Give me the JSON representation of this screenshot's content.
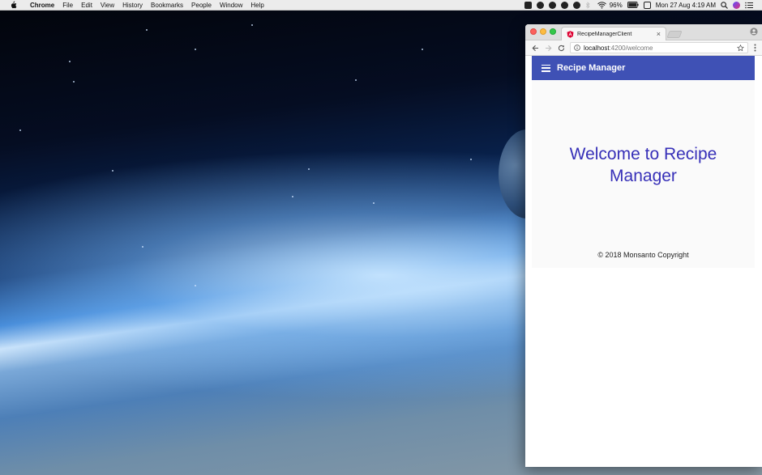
{
  "menubar": {
    "app_name": "Chrome",
    "items": [
      "File",
      "Edit",
      "View",
      "History",
      "Bookmarks",
      "People",
      "Window",
      "Help"
    ],
    "battery": "96%",
    "clock": "Mon 27 Aug  4:19 AM"
  },
  "browser": {
    "tab_title": "RecipeManagerClient",
    "tab_close": "×",
    "url_host": "localhost",
    "url_path": ":4200/welcome"
  },
  "app": {
    "title": "Recipe Manager",
    "welcome_line1": "Welcome to Recipe",
    "welcome_line2": "Manager",
    "footer": "© 2018 Monsanto Copyright",
    "accent_color": "#3f51b5",
    "heading_color": "#3730b8"
  }
}
